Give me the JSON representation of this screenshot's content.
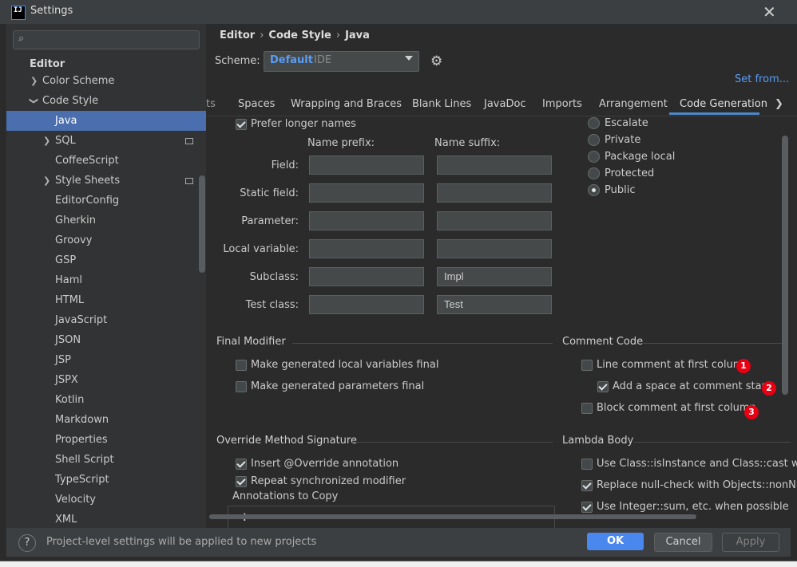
{
  "window": {
    "title": "Settings",
    "app_icon_text": "IJ"
  },
  "sidebar": {
    "search_placeholder": "",
    "section_title": "Editor",
    "items": [
      {
        "label": "Color Scheme",
        "expandable": true
      },
      {
        "label": "Code Style",
        "expanded": true
      },
      {
        "label": "Java",
        "selected": true
      },
      {
        "label": "SQL",
        "expandable": true
      },
      {
        "label": "CoffeeScript"
      },
      {
        "label": "Style Sheets",
        "expandable": true
      },
      {
        "label": "EditorConfig"
      },
      {
        "label": "Gherkin"
      },
      {
        "label": "Groovy"
      },
      {
        "label": "GSP"
      },
      {
        "label": "Haml"
      },
      {
        "label": "HTML"
      },
      {
        "label": "JavaScript"
      },
      {
        "label": "JSON"
      },
      {
        "label": "JSP"
      },
      {
        "label": "JSPX"
      },
      {
        "label": "Kotlin"
      },
      {
        "label": "Markdown"
      },
      {
        "label": "Properties"
      },
      {
        "label": "Shell Script"
      },
      {
        "label": "TypeScript"
      },
      {
        "label": "Velocity"
      },
      {
        "label": "XML"
      }
    ]
  },
  "breadcrumb": {
    "a": "Editor",
    "b": "Code Style",
    "c": "Java",
    "sep": "›"
  },
  "scheme": {
    "label": "Scheme:",
    "value": "Default",
    "sub": "IDE"
  },
  "set_from": "Set from...",
  "tabs": [
    "ts",
    "Spaces",
    "Wrapping and Braces",
    "Blank Lines",
    "JavaDoc",
    "Imports",
    "Arrangement",
    "Code Generation"
  ],
  "naming": {
    "prefer_longer": "Prefer longer names",
    "prefix_header": "Name prefix:",
    "suffix_header": "Name suffix:",
    "rows": [
      {
        "label": "Field:",
        "prefix": "",
        "suffix": ""
      },
      {
        "label": "Static field:",
        "prefix": "",
        "suffix": ""
      },
      {
        "label": "Parameter:",
        "prefix": "",
        "suffix": ""
      },
      {
        "label": "Local variable:",
        "prefix": "",
        "suffix": ""
      },
      {
        "label": "Subclass:",
        "prefix": "",
        "suffix": "Impl"
      },
      {
        "label": "Test class:",
        "prefix": "",
        "suffix": "Test"
      }
    ]
  },
  "visibility": {
    "options": [
      "Escalate",
      "Private",
      "Package local",
      "Protected",
      "Public"
    ],
    "selected": "Public"
  },
  "final_modifier": {
    "title": "Final Modifier",
    "local_vars": "Make generated local variables final",
    "params": "Make generated parameters final"
  },
  "comment_code": {
    "title": "Comment Code",
    "line_first": "Line comment at first column",
    "add_space": "Add a space at comment start",
    "block_first": "Block comment at first column",
    "badges": [
      "1",
      "2",
      "3"
    ]
  },
  "override": {
    "title": "Override Method Signature",
    "insert_override": "Insert @Override annotation",
    "repeat_sync": "Repeat synchronized modifier",
    "annotations_to_copy": "Annotations to Copy"
  },
  "lambda": {
    "title": "Lambda Body",
    "class_isinstance": "Use Class::isInstance and Class::cast when",
    "replace_null": "Replace null-check with Objects::nonNull o",
    "integer_sum": "Use Integer::sum, etc. when possible"
  },
  "footer": {
    "note": "Project-level settings will be applied to new projects",
    "ok": "OK",
    "cancel": "Cancel",
    "apply": "Apply",
    "help": "?"
  }
}
